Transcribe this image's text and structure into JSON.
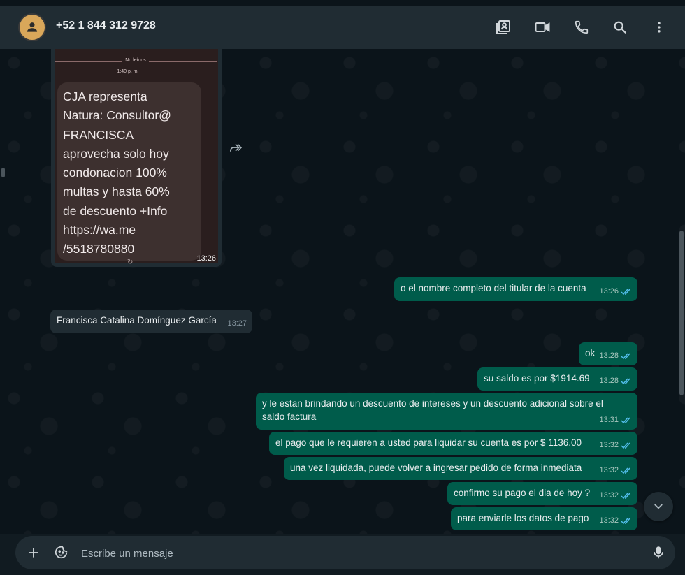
{
  "header": {
    "contact_name": "+52 1 844 312 9728",
    "icons": [
      "contact-card-icon",
      "video-call-icon",
      "phone-icon",
      "search-icon",
      "more-vert-icon"
    ]
  },
  "image_message": {
    "unread_label": "No leídos",
    "shot_time": "1:40 p. m.",
    "sms_text": "CJA representa\nNatura: Consultor@\nFRANCISCA\naprovecha solo hoy\ncondonacion 100%\nmultas y hasta 60%\nde descuento +Info",
    "sms_link_1": "https://wa.me",
    "sms_link_2": "/5518780880",
    "refresh_glyph": "↻",
    "time": "13:26"
  },
  "messages": [
    {
      "direction": "out",
      "text": "o el nombre completo del titular de la cuenta",
      "time": "13:26",
      "read": true
    },
    {
      "direction": "in",
      "text": "Francisca Catalina Domínguez García",
      "time": "13:27"
    },
    {
      "direction": "out",
      "text": "ok",
      "time": "13:28",
      "read": true
    },
    {
      "direction": "out",
      "text": "su saldo es por $1914.69",
      "time": "13:28",
      "read": true
    },
    {
      "direction": "out",
      "text": "y le estan brindando un descuento de intereses  y un descuento adicional sobre el saldo factura",
      "time": "13:31",
      "read": true
    },
    {
      "direction": "out",
      "text": "el pago que le requieren a usted para liquidar su cuenta es por $ 1136.00",
      "time": "13:32",
      "read": true
    },
    {
      "direction": "out",
      "text": "una vez liquidada, puede volver a ingresar pedido de forma inmediata",
      "time": "13:32",
      "read": true
    },
    {
      "direction": "out",
      "text": "confirmo su pago el dia de hoy ?",
      "time": "13:32",
      "read": true
    },
    {
      "direction": "out",
      "text": "para enviarle los datos de pago",
      "time": "13:32",
      "read": true
    }
  ],
  "composer": {
    "placeholder": "Escribe un mensaje"
  },
  "colors": {
    "outgoing_bubble": "#005c4b",
    "incoming_bubble": "#202c33",
    "read_ticks": "#53bdeb",
    "header_bg": "#202c33",
    "chat_bg": "#0b141a"
  }
}
